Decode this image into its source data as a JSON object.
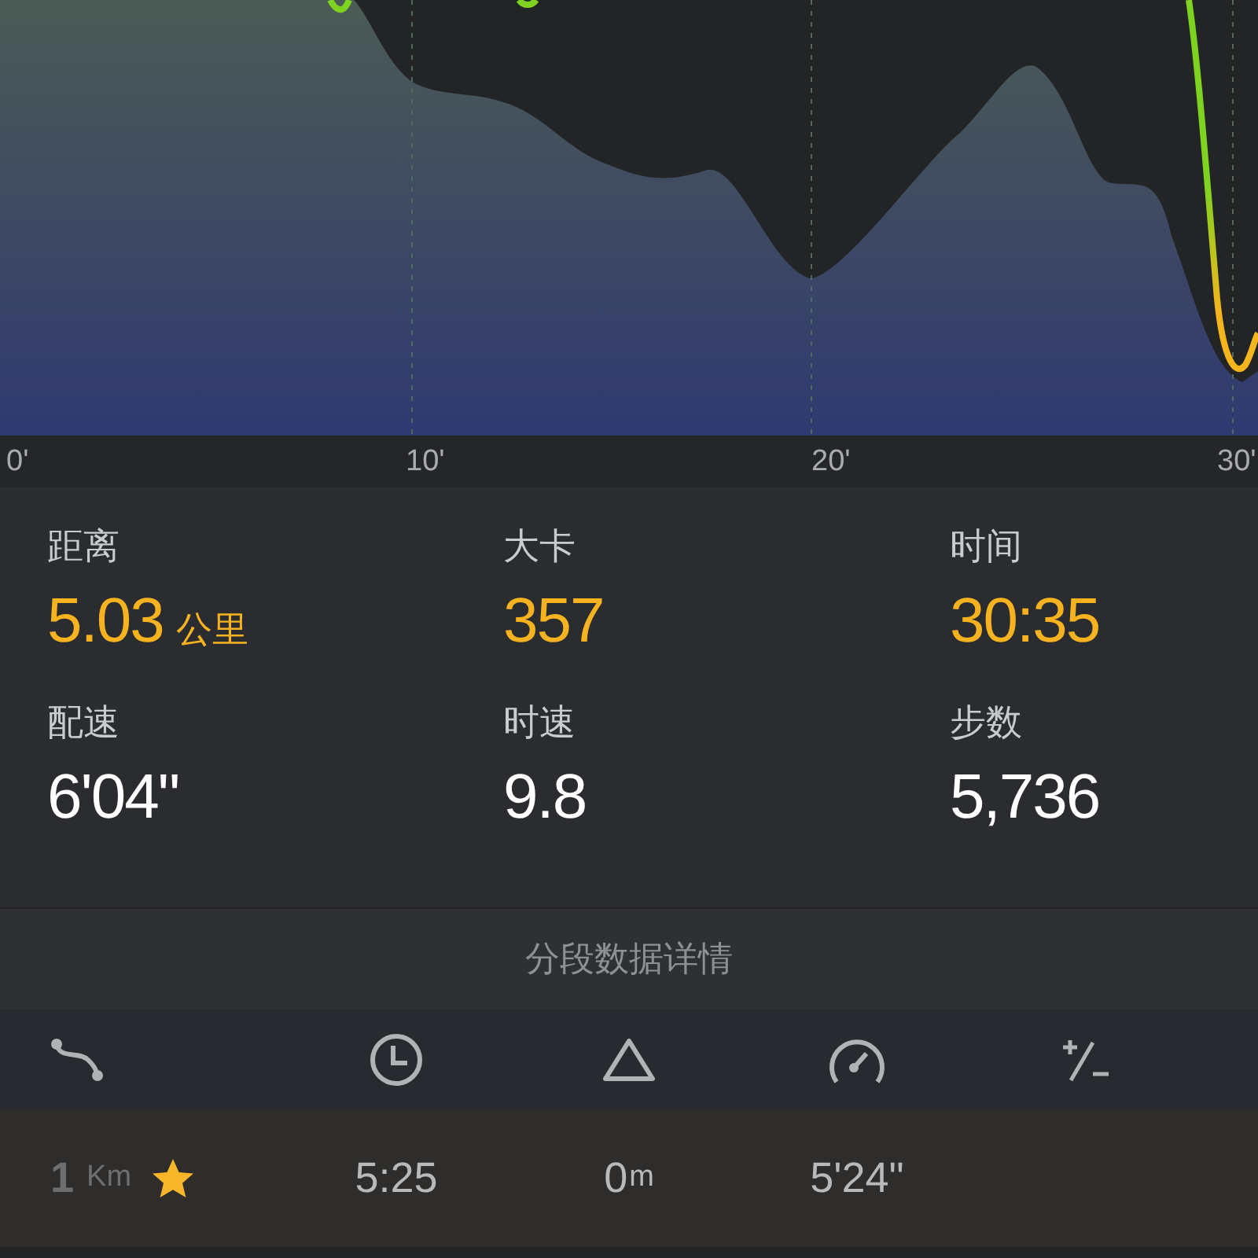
{
  "chart": {
    "x_labels": [
      "0'",
      "10'",
      "20'",
      "30'"
    ]
  },
  "stats": [
    {
      "label": "距离",
      "value": "5.03",
      "unit": "公里",
      "highlight": true
    },
    {
      "label": "大卡",
      "value": "357",
      "highlight": true
    },
    {
      "label": "时间",
      "value": "30:35",
      "highlight": true
    },
    {
      "label": "配速",
      "value": "6'04\"",
      "highlight": false
    },
    {
      "label": "时速",
      "value": "9.8",
      "highlight": false
    },
    {
      "label": "步数",
      "value": "5,736",
      "highlight": false
    }
  ],
  "segments": {
    "title": "分段数据详情",
    "rows": [
      {
        "distance": "1",
        "distance_unit": "Km",
        "starred": true,
        "time": "5:25",
        "elevation": "0",
        "elevation_unit": "m",
        "pace": "5'24\""
      }
    ]
  }
}
